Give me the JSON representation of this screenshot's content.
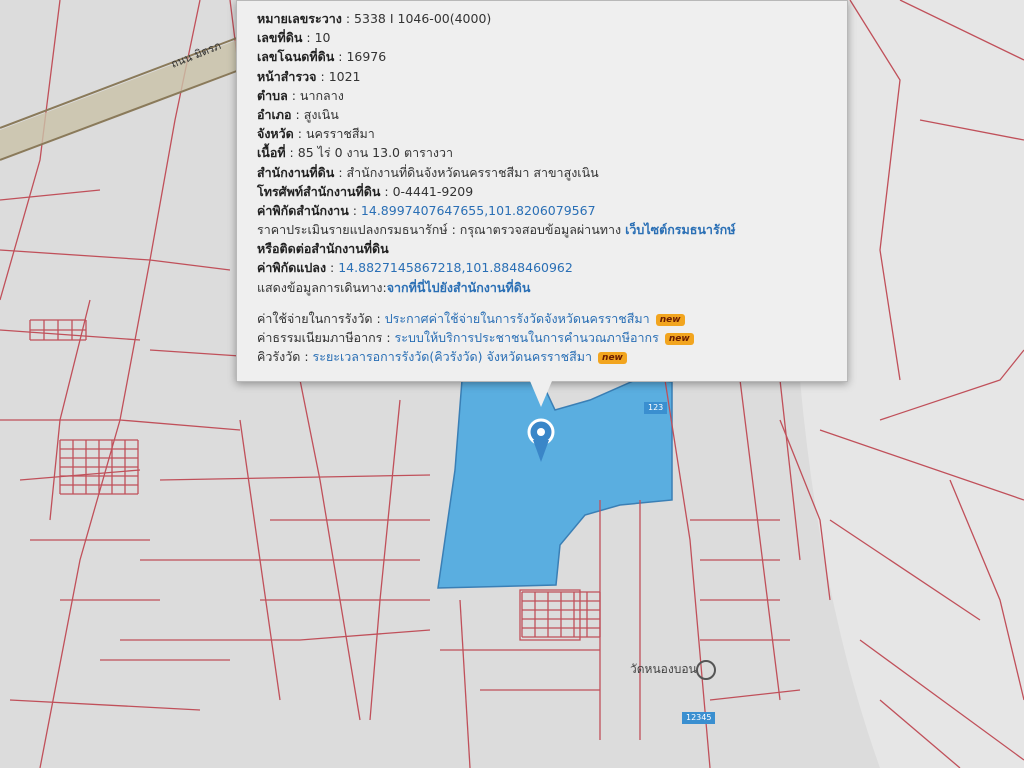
{
  "map": {
    "road_label": "ถนน มิตรภ",
    "place_label": "วัดหนองบอน",
    "parcel_color": "#5aaee0",
    "line_color": "#c0505a",
    "badges": [
      "123",
      "12345"
    ],
    "icons": [
      "location-pin-icon",
      "temple-icon"
    ]
  },
  "popup": {
    "rows": [
      {
        "label": "หมายเลขระวาง",
        "value": "5338 I 1046-00(4000)"
      },
      {
        "label": "เลขที่ดิน",
        "value": "10"
      },
      {
        "label": "เลขโฉนดที่ดิน",
        "value": "16976"
      },
      {
        "label": "หน้าสำรวจ",
        "value": "1021"
      },
      {
        "label": "ตำบล",
        "value": "นากลาง"
      },
      {
        "label": "อำเภอ",
        "value": "สูงเนิน"
      },
      {
        "label": "จังหวัด",
        "value": "นครราชสีมา"
      },
      {
        "label": "เนื้อที่",
        "value": "85 ไร่ 0 งาน 13.0 ตารางวา"
      },
      {
        "label": "สำนักงานที่ดิน",
        "value": "สำนักงานที่ดินจังหวัดนครราชสีมา สาขาสูงเนิน"
      },
      {
        "label": "โทรศัพท์สำนักงานที่ดิน",
        "value": "0-4441-9209"
      },
      {
        "label": "ค่าพิกัดสำนักงาน",
        "value": "14.8997407647655,101.8206079567"
      }
    ],
    "price_label": "ราคาประเมินรายแปลงกรมธนารักษ์",
    "price_text": "กรุณาตรวจสอบข้อมูลผ่านทาง",
    "price_link": "เว็บไซต์กรมธนารักษ์",
    "price_text2": "หรือติดต่อสำนักงานที่ดิน",
    "parcel_coord_label": "ค่าพิกัดแปลง",
    "parcel_coord_value": "14.8827145867218,101.8848460962",
    "route_label": "แสดงข้อมูลการเดินทาง",
    "route_link": "จากที่นี่ไปยังสำนักงานที่ดิน",
    "fees": [
      {
        "label": "ค่าใช้จ่ายในการรังวัด",
        "link": "ประกาศค่าใช้จ่ายในการรังวัดจังหวัดนครราชสีมา",
        "badge": "new"
      },
      {
        "label": "ค่าธรรมเนียมภาษีอากร",
        "link": "ระบบให้บริการประชาชนในการคำนวณภาษีอากร",
        "badge": "new"
      },
      {
        "label": "คิวรังวัด",
        "link": "ระยะเวลารอการรังวัด(คิวรังวัด) จังหวัดนครราชสีมา",
        "badge": "new"
      }
    ]
  }
}
